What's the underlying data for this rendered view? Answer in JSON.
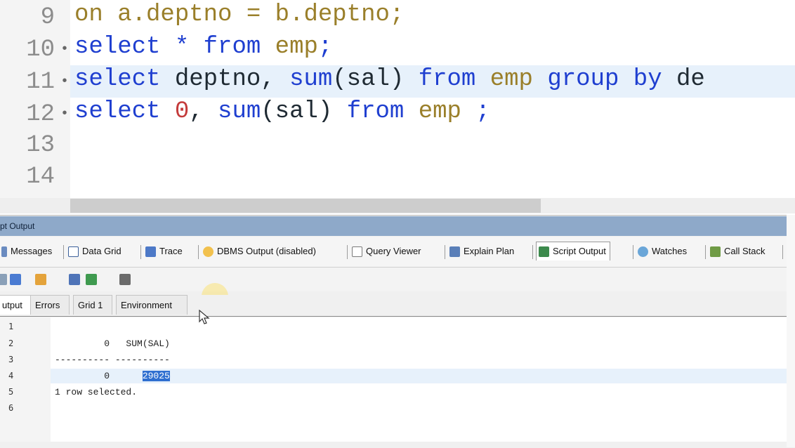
{
  "editor": {
    "lines": [
      {
        "num": "9",
        "dot": false
      },
      {
        "num": "10",
        "dot": true
      },
      {
        "num": "11",
        "dot": true
      },
      {
        "num": "12",
        "dot": true
      },
      {
        "num": "13",
        "dot": false
      },
      {
        "num": "14",
        "dot": false
      }
    ],
    "line9": {
      "p1": "on a.deptno = b.deptno;"
    },
    "line10": {
      "select": "select",
      "star": " * ",
      "from": "from",
      "table": " emp",
      "semi": ";"
    },
    "line11": {
      "select": "select",
      "cols": " deptno, ",
      "sum": "sum",
      "arg": "(sal)",
      "from": " from",
      "table": " emp",
      "group": " group by",
      "rest": " de"
    },
    "line12": {
      "select": "select",
      "zero": " 0",
      "comma": ", ",
      "sum": "sum",
      "arg": "(sal)",
      "from": " from",
      "table": " emp",
      "semi": " ;"
    }
  },
  "panel": {
    "title": "pt Output",
    "tabs": [
      {
        "label": "Messages",
        "icon": "messages-icon"
      },
      {
        "label": "Data Grid",
        "icon": "data-grid-icon"
      },
      {
        "label": "Trace",
        "icon": "trace-icon"
      },
      {
        "label": "DBMS Output (disabled)",
        "icon": "dbms-output-icon"
      },
      {
        "label": "Query Viewer",
        "icon": "query-viewer-icon"
      },
      {
        "label": "Explain Plan",
        "icon": "explain-plan-icon"
      },
      {
        "label": "Script Output",
        "icon": "script-output-icon"
      },
      {
        "label": "Watches",
        "icon": "watches-icon"
      },
      {
        "label": "Call Stack",
        "icon": "call-stack-icon"
      }
    ],
    "subtabs": [
      "utput",
      "Errors",
      "Grid 1",
      "Environment"
    ],
    "output_lines": {
      "nums": [
        "1",
        "2",
        "3",
        "4",
        "5",
        "6"
      ],
      "line2": "         0   SUM(SAL)",
      "line3": "---------- ----------",
      "line4_a": "         0      ",
      "line4_sel": "29025",
      "line5": "1 row selected."
    }
  },
  "colors": {
    "keyword": "#1f3fd0",
    "table": "#9a7f2a",
    "number": "#c43b3b",
    "panel_title": "#8ea9c9",
    "selection": "#2f6fd0"
  }
}
